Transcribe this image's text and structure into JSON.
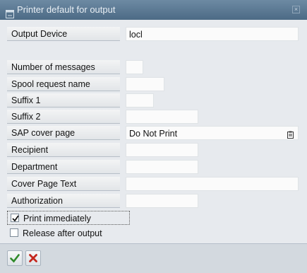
{
  "window": {
    "title": "Printer default for output"
  },
  "fields": {
    "output_device": {
      "label": "Output Device",
      "value": "locl"
    },
    "number_of_messages": {
      "label": "Number of messages",
      "value": ""
    },
    "spool_request_name": {
      "label": "Spool request name",
      "value": ""
    },
    "suffix1": {
      "label": "Suffix 1",
      "value": ""
    },
    "suffix2": {
      "label": "Suffix 2",
      "value": ""
    },
    "sap_cover_page": {
      "label": "SAP cover page",
      "value": "Do Not Print"
    },
    "recipient": {
      "label": "Recipient",
      "value": ""
    },
    "department": {
      "label": "Department",
      "value": ""
    },
    "cover_page_text": {
      "label": "Cover Page Text",
      "value": ""
    },
    "authorization": {
      "label": "Authorization",
      "value": ""
    }
  },
  "checkboxes": {
    "print_immediately": {
      "label": "Print immediately",
      "checked": true
    },
    "release_after_output": {
      "label": "Release after output",
      "checked": false
    }
  },
  "icons": {
    "title": "window-icon",
    "close": "close-icon",
    "value_help": "value-help-icon",
    "confirm": "checkmark-icon",
    "cancel": "cancel-icon"
  },
  "colors": {
    "titlebar": "#5a7893",
    "confirm": "#2f8a2a",
    "cancel": "#c4261d"
  }
}
